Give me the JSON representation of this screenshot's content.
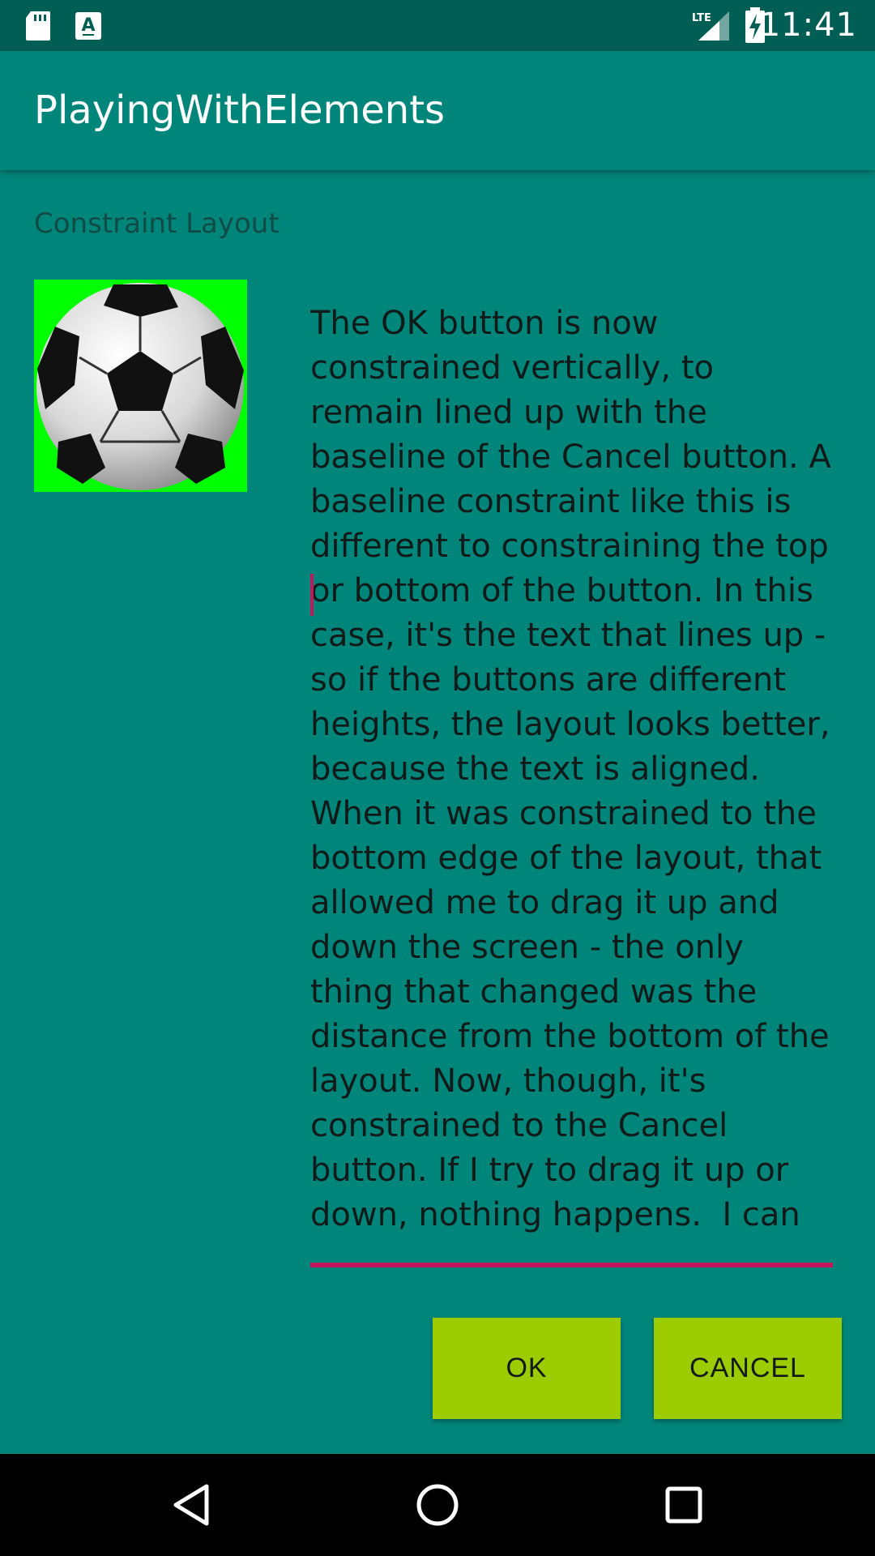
{
  "status_bar": {
    "time": "11:41",
    "network_label": "LTE",
    "icons": [
      "sd-card-icon",
      "a-notification-icon",
      "lte-signal-icon",
      "battery-charging-icon"
    ]
  },
  "app_bar": {
    "title": "PlayingWithElements"
  },
  "content": {
    "section_label": "Constraint Layout",
    "image": {
      "icon": "soccer-ball-icon",
      "background": "#00ff00"
    },
    "body_text": "The OK button is now constrained vertically, to remain lined up with the baseline of the Cancel button. A baseline constraint like this is different to constraining the top or bottom of the button. In this case, it's the text that lines up - so if the buttons are different heights, the layout looks better, because the text is aligned.  When it was constrained to the bottom edge of the layout, that allowed me to drag it up and down the screen - the only thing that changed was the distance from the bottom of the layout. Now, though, it's constrained to the Cancel button. If I try to drag it up or down, nothing happens.  I can"
  },
  "buttons": {
    "ok_label": "OK",
    "cancel_label": "CANCEL"
  },
  "nav_bar": {
    "icons": [
      "back-icon",
      "home-icon",
      "recents-icon"
    ]
  },
  "colors": {
    "background": "#00857a",
    "status_bar": "#005e55",
    "button": "#9ccc00",
    "accent": "#c2185b",
    "image_background": "#00ff00"
  }
}
